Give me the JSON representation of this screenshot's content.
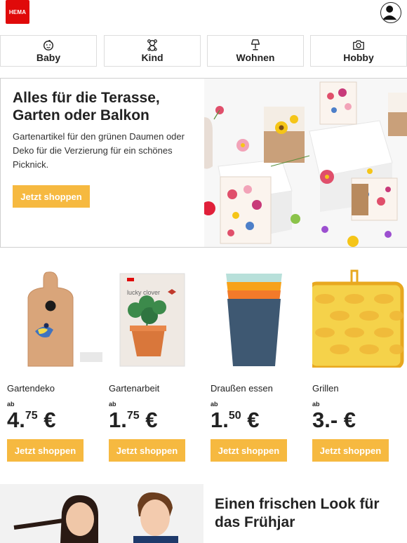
{
  "header": {
    "logo_text": "HEMA",
    "account_icon": "user-icon"
  },
  "categories": [
    {
      "label": "Baby",
      "icon": "baby-face-icon"
    },
    {
      "label": "Kind",
      "icon": "teddy-bear-icon"
    },
    {
      "label": "Wohnen",
      "icon": "lamp-icon"
    },
    {
      "label": "Hobby",
      "icon": "camera-icon"
    }
  ],
  "hero": {
    "title": "Alles für die Terasse, Garten oder Balkon",
    "text": "Gartenartikel für den grünen Daumen oder Deko für die Verzierung für ein schönes Picknick.",
    "button": "Jetzt shoppen",
    "packet_text": "lucky clover"
  },
  "products": [
    {
      "name": "Gartendeko",
      "prefix": "ab",
      "price_main": "4.",
      "price_sup": "75",
      "currency": " €",
      "button": "Jetzt shoppen"
    },
    {
      "name": "Gartenarbeit",
      "prefix": "ab",
      "price_main": "1.",
      "price_sup": "75",
      "currency": " €",
      "button": "Jetzt shoppen",
      "packet_text": "lucky clover"
    },
    {
      "name": "Draußen essen",
      "prefix": "ab",
      "price_main": "1.",
      "price_sup": "50",
      "currency": " €",
      "button": "Jetzt shoppen"
    },
    {
      "name": "Grillen",
      "prefix": "ab",
      "price_main": "3.-",
      "price_sup": "",
      "currency": " €",
      "button": "Jetzt shoppen"
    }
  ],
  "promo": {
    "title": "Einen frischen Look für das Frühjar"
  },
  "colors": {
    "brand_red": "#e00a0a",
    "button_yellow": "#f6b940"
  }
}
